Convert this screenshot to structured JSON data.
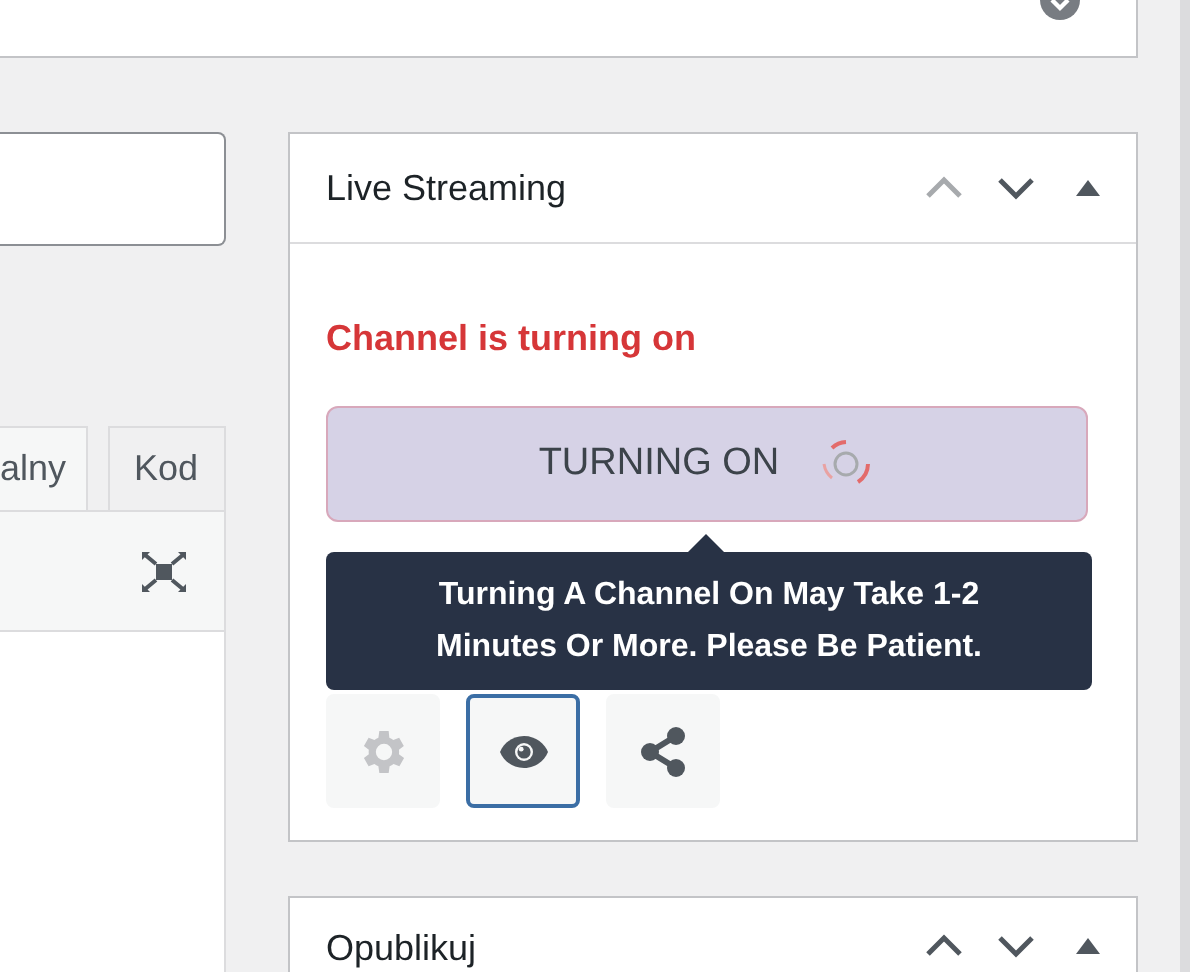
{
  "editor": {
    "tabs": [
      {
        "label": "alny",
        "selected": true
      },
      {
        "label": "Kod",
        "selected": false
      }
    ]
  },
  "live_streaming": {
    "title": "Live Streaming",
    "controls": [
      {
        "kind": "up",
        "disabled": true
      },
      {
        "kind": "down",
        "disabled": false
      },
      {
        "kind": "toggle",
        "disabled": false
      }
    ],
    "status": "Channel is turning on",
    "button": {
      "label": "TURNING ON",
      "busy": true
    },
    "tooltip": "Turning A Channel On May Take 1-2 Minutes Or More. Please Be Patient.",
    "actions": [
      {
        "kind": "settings",
        "disabled": true,
        "selected": false
      },
      {
        "kind": "preview",
        "disabled": false,
        "selected": true
      },
      {
        "kind": "share",
        "disabled": false,
        "selected": false
      }
    ]
  },
  "publish": {
    "title": "Opublikuj",
    "controls": [
      {
        "kind": "up",
        "disabled": false
      },
      {
        "kind": "down",
        "disabled": false
      },
      {
        "kind": "toggle",
        "disabled": false
      }
    ]
  }
}
